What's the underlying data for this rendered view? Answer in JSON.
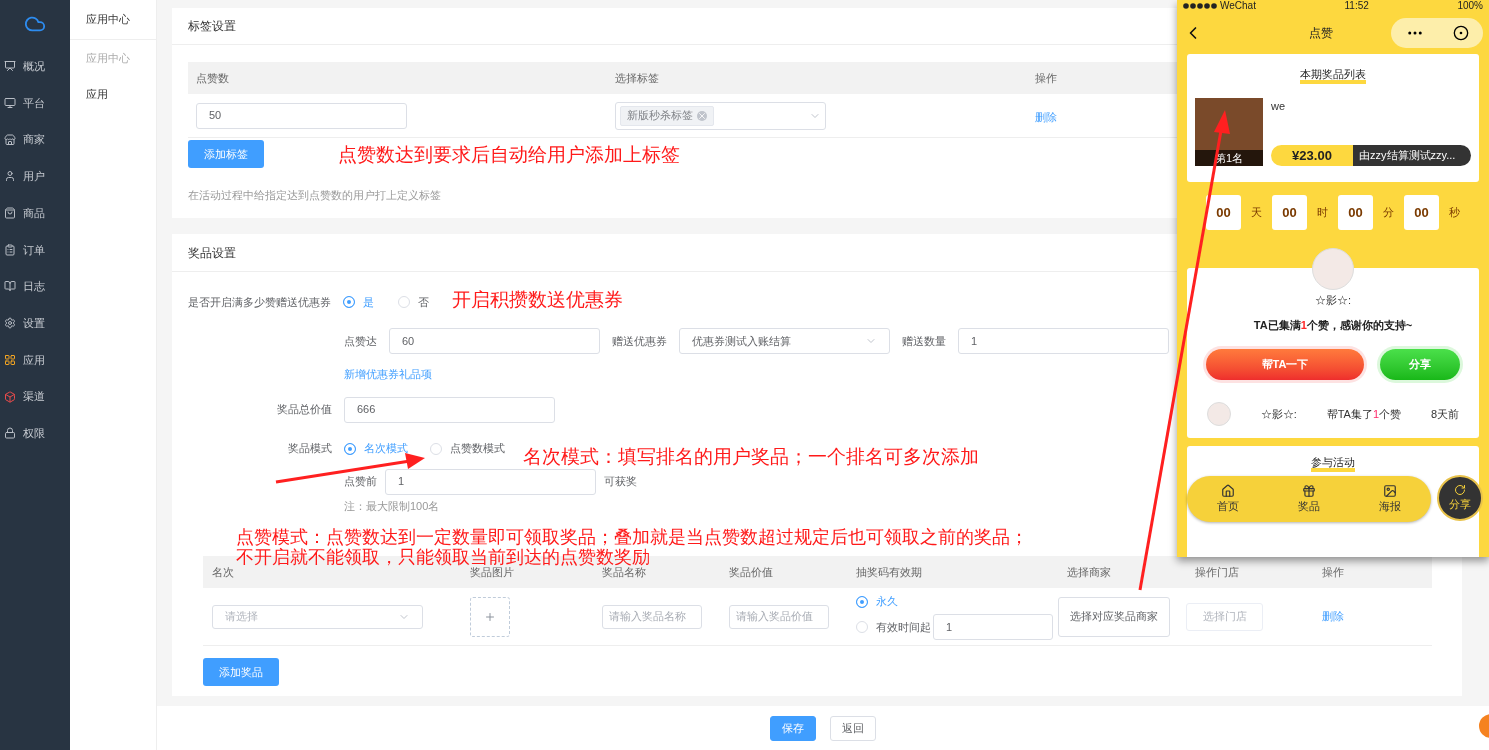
{
  "sidebar": {
    "items": [
      {
        "label": "概况"
      },
      {
        "label": "平台"
      },
      {
        "label": "商家"
      },
      {
        "label": "用户"
      },
      {
        "label": "商品"
      },
      {
        "label": "订单"
      },
      {
        "label": "日志"
      },
      {
        "label": "设置"
      },
      {
        "label": "应用"
      },
      {
        "label": "渠道"
      },
      {
        "label": "权限"
      }
    ]
  },
  "subnav": {
    "title": "应用中心",
    "group": "应用中心",
    "items": [
      {
        "label": "应用"
      }
    ]
  },
  "tag_settings": {
    "title": "标签设置",
    "columns": [
      "点赞数",
      "选择标签",
      "操作"
    ],
    "rows": [
      {
        "likes": "50",
        "tags": [
          "新版秒杀标签"
        ],
        "action": "删除"
      }
    ],
    "add_button": "添加标签",
    "hint": "在活动过程中给指定达到点赞数的用户打上定义标签"
  },
  "prize_settings": {
    "title": "奖品设置",
    "coupon_toggle": {
      "label": "是否开启满多少赞赠送优惠券",
      "options": [
        {
          "label": "是",
          "selected": true
        },
        {
          "label": "否",
          "selected": false
        }
      ]
    },
    "coupon_row": {
      "likes_label": "点赞达",
      "likes_value": "60",
      "coupon_label": "赠送优惠券",
      "coupon_value": "优惠券测试入账结算",
      "qty_label": "赠送数量",
      "qty_value": "1"
    },
    "add_coupon_link": "新增优惠券礼品项",
    "total_value": {
      "label": "奖品总价值",
      "value": "666"
    },
    "mode": {
      "label": "奖品模式",
      "options": [
        {
          "label": "名次模式",
          "selected": true
        },
        {
          "label": "点赞数模式",
          "selected": false
        }
      ]
    },
    "rank_row": {
      "label": "点赞前",
      "value": "1",
      "suffix": "可获奖"
    },
    "note": "注：最大限制100名",
    "table": {
      "columns": [
        "名次",
        "奖品图片",
        "奖品名称",
        "奖品价值",
        "抽奖码有效期",
        "选择商家",
        "操作门店",
        "操作"
      ],
      "rows": [
        {
          "rank_placeholder": "请选择",
          "name_placeholder": "请输入奖品名称",
          "value_placeholder": "请输入奖品价值",
          "validity": [
            {
              "label": "永久",
              "selected": true
            },
            {
              "label": "有效时间起",
              "selected": false
            }
          ],
          "validity_value": "1",
          "merchant_button": "选择对应奖品商家",
          "store_button": "选择门店",
          "action": "删除"
        }
      ]
    },
    "add_button": "添加奖品"
  },
  "footer": {
    "buttons": [
      {
        "label": "保存",
        "kind": "primary"
      },
      {
        "label": "返回",
        "kind": "default"
      }
    ]
  },
  "annotations": [
    {
      "text": "点赞数达到要求后自动给用户添加上标签"
    },
    {
      "text": "开启积攒数送优惠券"
    },
    {
      "text": "名次模式：填写排名的用户奖品；一个排名可多次添加"
    },
    {
      "text": "点赞模式：点赞数达到一定数量即可领取奖品；叠加就是当点赞数超过规定后也可领取之前的奖品；"
    },
    {
      "text": "不开启就不能领取，只能领取当前到达的点赞数奖励"
    }
  ],
  "phone": {
    "status": {
      "carrier": "WeChat",
      "time": "11:52",
      "battery": "100%"
    },
    "title": "点赞",
    "prize_list": {
      "title": "本期奖品列表",
      "items": [
        {
          "name": "we",
          "rank": "第1名",
          "price": "¥23.00",
          "merchant": "由zzy结算测试zzy..."
        }
      ]
    },
    "countdown": [
      {
        "value": "00",
        "unit": "天"
      },
      {
        "value": "00",
        "unit": "时"
      },
      {
        "value": "00",
        "unit": "分"
      },
      {
        "value": "00",
        "unit": "秒"
      }
    ],
    "user": {
      "name": "☆影☆:",
      "message_start": "TA已集满",
      "count": "1",
      "message_end": "个赞，感谢你的支持~"
    },
    "buttons": [
      {
        "label": "帮TA一下",
        "kind": "help"
      },
      {
        "label": "分享",
        "kind": "share"
      }
    ],
    "records": [
      {
        "name": "☆影☆:",
        "action_start": "帮TA集了",
        "count": "1",
        "action_end": "个赞",
        "time": "8天前"
      }
    ],
    "section_title": "参与活动",
    "tabbar": [
      {
        "label": "首页"
      },
      {
        "label": "奖品"
      },
      {
        "label": "海报"
      }
    ],
    "share_fab": "分享"
  }
}
